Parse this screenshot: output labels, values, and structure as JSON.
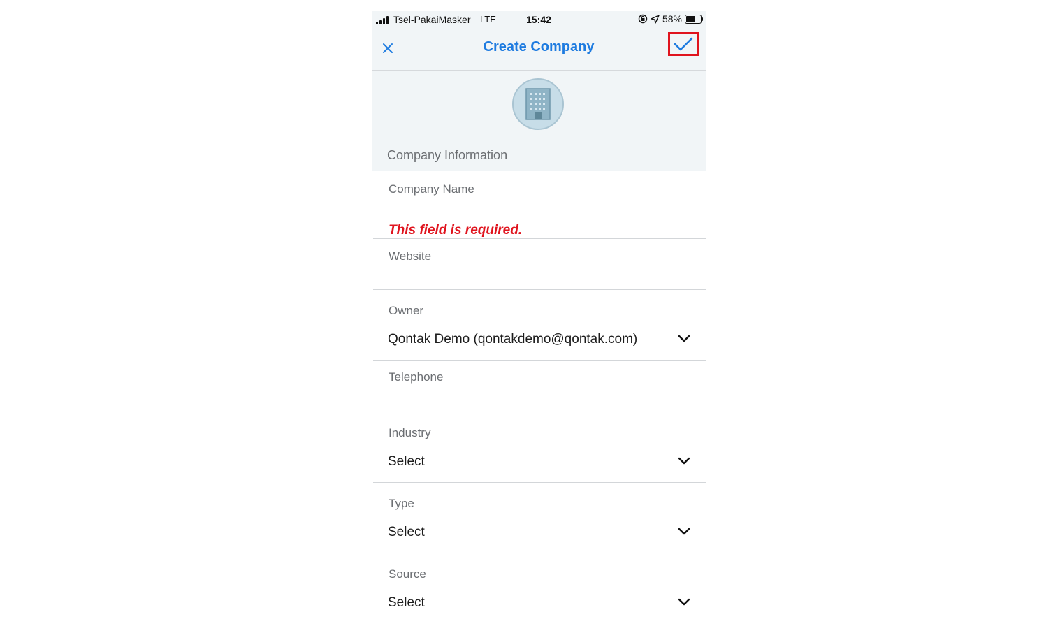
{
  "status_bar": {
    "carrier": "Tsel-PakaiMasker",
    "network": "LTE",
    "time": "15:42",
    "battery_percent": "58%",
    "battery_level": 0.58
  },
  "nav": {
    "title": "Create Company",
    "close_icon": "close-icon",
    "confirm_icon": "checkmark-icon",
    "accent_color": "#1e7be0",
    "highlight_color": "#e0141e"
  },
  "header": {
    "avatar_icon": "building-icon",
    "section_title": "Company Information"
  },
  "form": {
    "company_name": {
      "label": "Company Name",
      "value": "",
      "error": "This field is required."
    },
    "website": {
      "label": "Website",
      "value": ""
    },
    "owner": {
      "label": "Owner",
      "value": "Qontak Demo (qontakdemo@qontak.com)"
    },
    "telephone": {
      "label": "Telephone",
      "value": ""
    },
    "industry": {
      "label": "Industry",
      "value": "Select"
    },
    "type": {
      "label": "Type",
      "value": "Select"
    },
    "source": {
      "label": "Source",
      "value": "Select"
    }
  }
}
